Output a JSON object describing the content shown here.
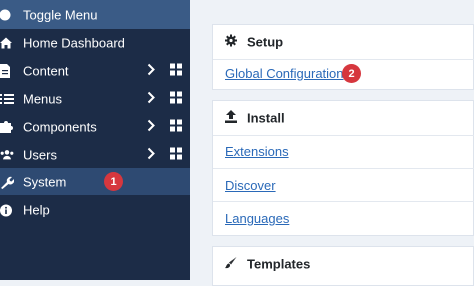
{
  "sidebar": {
    "toggle_label": "Toggle Menu",
    "items": [
      {
        "label": "Home Dashboard",
        "icon": "home-icon"
      },
      {
        "label": "Content",
        "icon": "file-icon"
      },
      {
        "label": "Menus",
        "icon": "list-icon"
      },
      {
        "label": "Components",
        "icon": "puzzle-icon"
      },
      {
        "label": "Users",
        "icon": "users-icon"
      },
      {
        "label": "System",
        "icon": "wrench-icon"
      },
      {
        "label": "Help",
        "icon": "info-icon"
      }
    ],
    "system_badge": "1"
  },
  "main": {
    "setup": {
      "title": "Setup",
      "link": "Global Configuration",
      "badge": "2"
    },
    "install": {
      "title": "Install",
      "links": [
        "Extensions",
        "Discover",
        "Languages"
      ]
    },
    "templates": {
      "title": "Templates"
    }
  },
  "colors": {
    "sidebar_bg": "#1c2c47",
    "toggle_bg": "#3a5b86",
    "active_bg": "#2e4a72",
    "badge": "#d6373e",
    "link": "#2a69b8"
  }
}
